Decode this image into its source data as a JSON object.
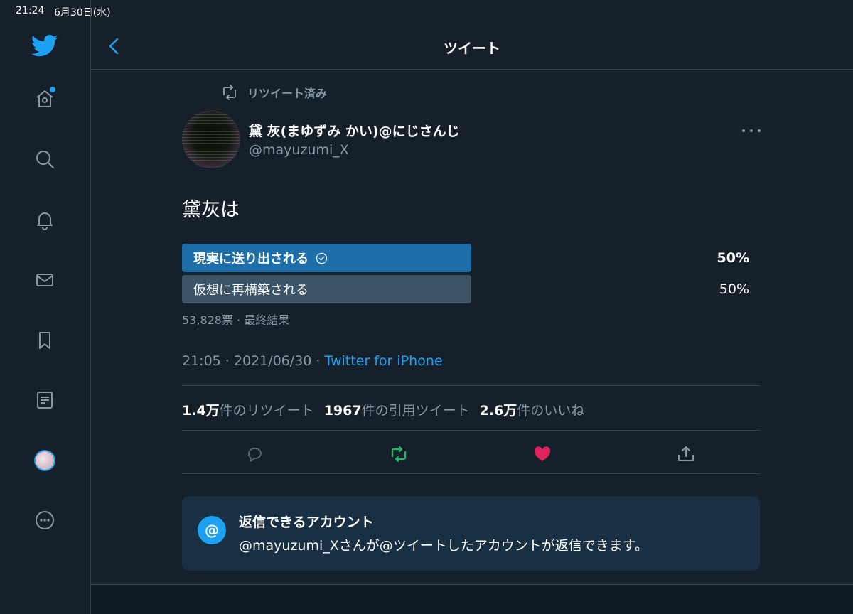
{
  "status_bar": {
    "time": "21:24",
    "date": "6月30日(水)"
  },
  "header": {
    "title": "ツイート"
  },
  "sidebar": {
    "icons": [
      "twitter-logo",
      "home-icon",
      "search-icon",
      "bell-icon",
      "mail-icon",
      "bookmark-icon",
      "list-icon",
      "profile-avatar",
      "more-icon"
    ]
  },
  "tweet": {
    "retweet_label": "リツイート済み",
    "author_name": "黛 灰(まゆずみ かい)@にじさんじ",
    "author_handle": "@mayuzumi_X",
    "text": "黛灰は",
    "poll": {
      "options": [
        {
          "label": "現実に送り出される",
          "percent": "50%",
          "winner": true
        },
        {
          "label": "仮想に再構築される",
          "percent": "50%",
          "winner": false
        }
      ],
      "meta": "53,828票 · 最終結果"
    },
    "timestamp": "21:05 · 2021/06/30 · ",
    "source": "Twitter for iPhone",
    "stats": {
      "retweets_count": "1.4万",
      "retweets_label": "件のリツイート",
      "quotes_count": "1967",
      "quotes_label": "件の引用ツイート",
      "likes_count": "2.6万",
      "likes_label": "件のいいね"
    }
  },
  "reply_notice": {
    "icon": "@",
    "title": "返信できるアカウント",
    "description": "@mayuzumi_Xさんが@ツイートしたアカウントが返信できます。"
  },
  "colors": {
    "background": "#15202b",
    "accent": "#1da1f2",
    "retweet_green": "#17bf63",
    "like_red": "#e0245e",
    "muted": "#8899a6"
  }
}
